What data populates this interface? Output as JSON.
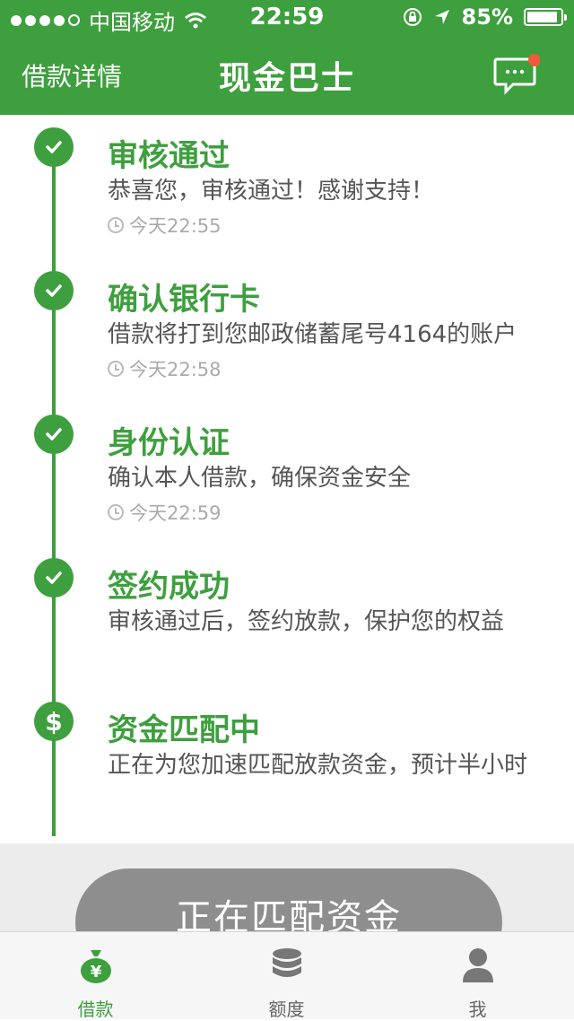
{
  "status_bar": {
    "carrier": "中国移动",
    "time": "22:59",
    "battery": "85%"
  },
  "nav": {
    "left_label": "借款详情",
    "title": "现金巴士"
  },
  "steps": [
    {
      "title": "审核通过",
      "desc": "恭喜您，审核通过！感谢支持！",
      "time": "今天22:55"
    },
    {
      "title": "确认银行卡",
      "desc": "借款将打到您邮政储蓄尾号4164的账户",
      "time": "今天22:58"
    },
    {
      "title": "身份认证",
      "desc": "确认本人借款，确保资金安全",
      "time": "今天22:59"
    },
    {
      "title": "签约成功",
      "desc": "审核通过后，签约放款，保护您的权益"
    },
    {
      "title": "资金匹配中",
      "desc": "正在为您加速匹配放款资金，预计半小时"
    }
  ],
  "action_button": "正在匹配资金",
  "tabbar": [
    {
      "label": "借款",
      "icon": "money-bag-icon"
    },
    {
      "label": "额度",
      "icon": "coin-stack-icon"
    },
    {
      "label": "我",
      "icon": "person-icon"
    }
  ],
  "colors": {
    "brand_green": "#3e9f3e",
    "button_gray": "#8e8e8e",
    "notification_red": "#ee5a3a"
  }
}
